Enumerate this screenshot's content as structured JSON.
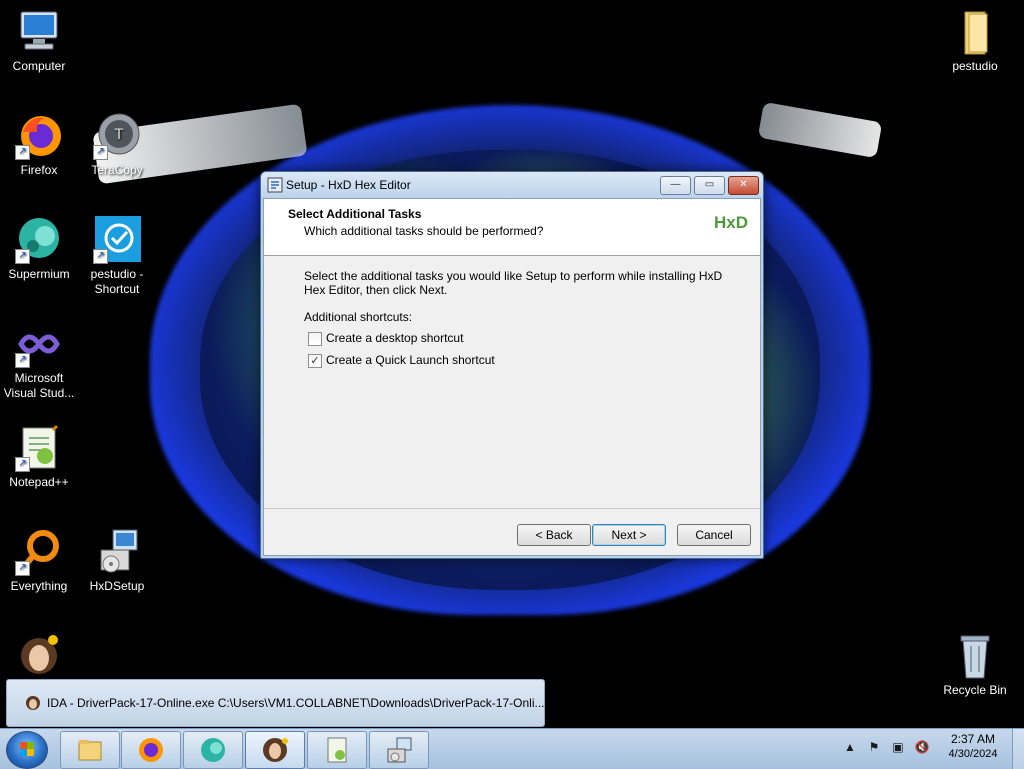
{
  "desktop": {
    "icons": [
      {
        "label": "Computer",
        "icon": "computer-icon"
      },
      {
        "label": "pestudio",
        "icon": "folder-icon"
      },
      {
        "label": "Firefox",
        "icon": "firefox-icon"
      },
      {
        "label": "TeraCopy",
        "icon": "teracopy-icon"
      },
      {
        "label": "Supermium",
        "icon": "supermium-icon"
      },
      {
        "label": "pestudio - Shortcut",
        "icon": "pestudio-icon"
      },
      {
        "label": "Microsoft Visual Stud...",
        "icon": "visual-studio-icon"
      },
      {
        "label": "Notepad++",
        "icon": "notepadpp-icon"
      },
      {
        "label": "Everything",
        "icon": "everything-icon"
      },
      {
        "label": "HxDSetup",
        "icon": "installer-icon"
      },
      {
        "label": "Recycle Bin",
        "icon": "recycle-bin-icon"
      }
    ]
  },
  "dialog": {
    "title": "Setup - HxD Hex Editor",
    "header_title": "Select Additional Tasks",
    "header_subtitle": "Which additional tasks should be performed?",
    "logo_text": "HxD",
    "body_text": "Select the additional tasks you would like Setup to perform while installing HxD Hex Editor, then click Next.",
    "section_label": "Additional shortcuts:",
    "checkboxes": [
      {
        "label": "Create a desktop shortcut",
        "checked": false
      },
      {
        "label": "Create a Quick Launch shortcut",
        "checked": true
      }
    ],
    "buttons": {
      "back": "< Back",
      "next": "Next >",
      "cancel": "Cancel"
    },
    "window_controls": {
      "minimize": "—",
      "maximize": "▭",
      "close": "✕"
    }
  },
  "taskbar": {
    "thumbnail_text": "IDA - DriverPack-17-Online.exe C:\\Users\\VM1.COLLABNET\\Downloads\\DriverPack-17-Onli...",
    "items": [
      {
        "name": "explorer",
        "icon": "explorer-icon"
      },
      {
        "name": "firefox",
        "icon": "firefox-icon"
      },
      {
        "name": "supermium",
        "icon": "supermium-icon"
      },
      {
        "name": "ida",
        "icon": "ida-icon"
      },
      {
        "name": "notepadpp",
        "icon": "notepadpp-icon"
      },
      {
        "name": "hxd-setup",
        "icon": "installer-icon"
      }
    ],
    "clock_time": "2:37 AM",
    "clock_date": "4/30/2024"
  }
}
